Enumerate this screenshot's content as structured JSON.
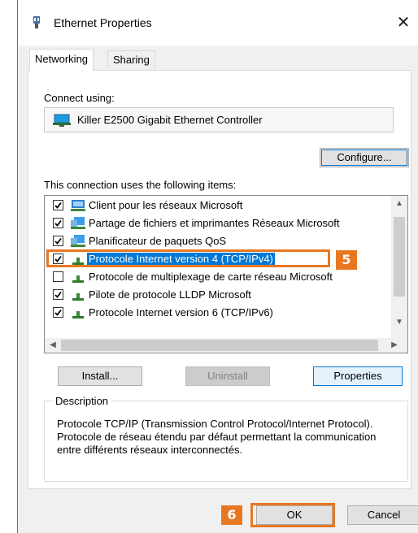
{
  "window": {
    "title": "Ethernet Properties",
    "close_glyph": "✕",
    "icon": "network-adapter-icon"
  },
  "tabs": [
    {
      "label": "Networking",
      "active": true
    },
    {
      "label": "Sharing",
      "active": false
    }
  ],
  "connect": {
    "label": "Connect using:",
    "adapter_name": "Killer E2500 Gigabit Ethernet Controller",
    "configure_label": "Configure..."
  },
  "items": {
    "label": "This connection uses the following items:",
    "rows": [
      {
        "label": "Client pour les réseaux Microsoft",
        "checked": true,
        "icon": "network-client-icon"
      },
      {
        "label": "Partage de fichiers et imprimantes Réseaux Microsoft",
        "checked": true,
        "icon": "network-service-icon"
      },
      {
        "label": "Planificateur de paquets QoS",
        "checked": true,
        "icon": "network-service-icon"
      },
      {
        "label": "Protocole Internet version 4 (TCP/IPv4)",
        "checked": true,
        "icon": "protocol-icon",
        "selected": true
      },
      {
        "label": "Protocole de multiplexage de carte réseau Microsoft",
        "checked": false,
        "icon": "protocol-icon"
      },
      {
        "label": "Pilote de protocole LLDP Microsoft",
        "checked": true,
        "icon": "protocol-icon"
      },
      {
        "label": "Protocole Internet version 6 (TCP/IPv6)",
        "checked": true,
        "icon": "protocol-icon"
      }
    ]
  },
  "buttons": {
    "install": "Install...",
    "uninstall": "Uninstall",
    "properties": "Properties",
    "ok": "OK",
    "cancel": "Cancel"
  },
  "description": {
    "legend": "Description",
    "text": "Protocole TCP/IP (Transmission Control Protocol/Internet Protocol). Protocole de réseau étendu par défaut permettant la communication entre différents réseaux interconnectés."
  },
  "annotations": {
    "step_5": "5",
    "step_6": "6",
    "highlight_color": "#e87722"
  },
  "colors": {
    "selection": "#0078d7",
    "dialog_bg": "#f0f0f0"
  }
}
